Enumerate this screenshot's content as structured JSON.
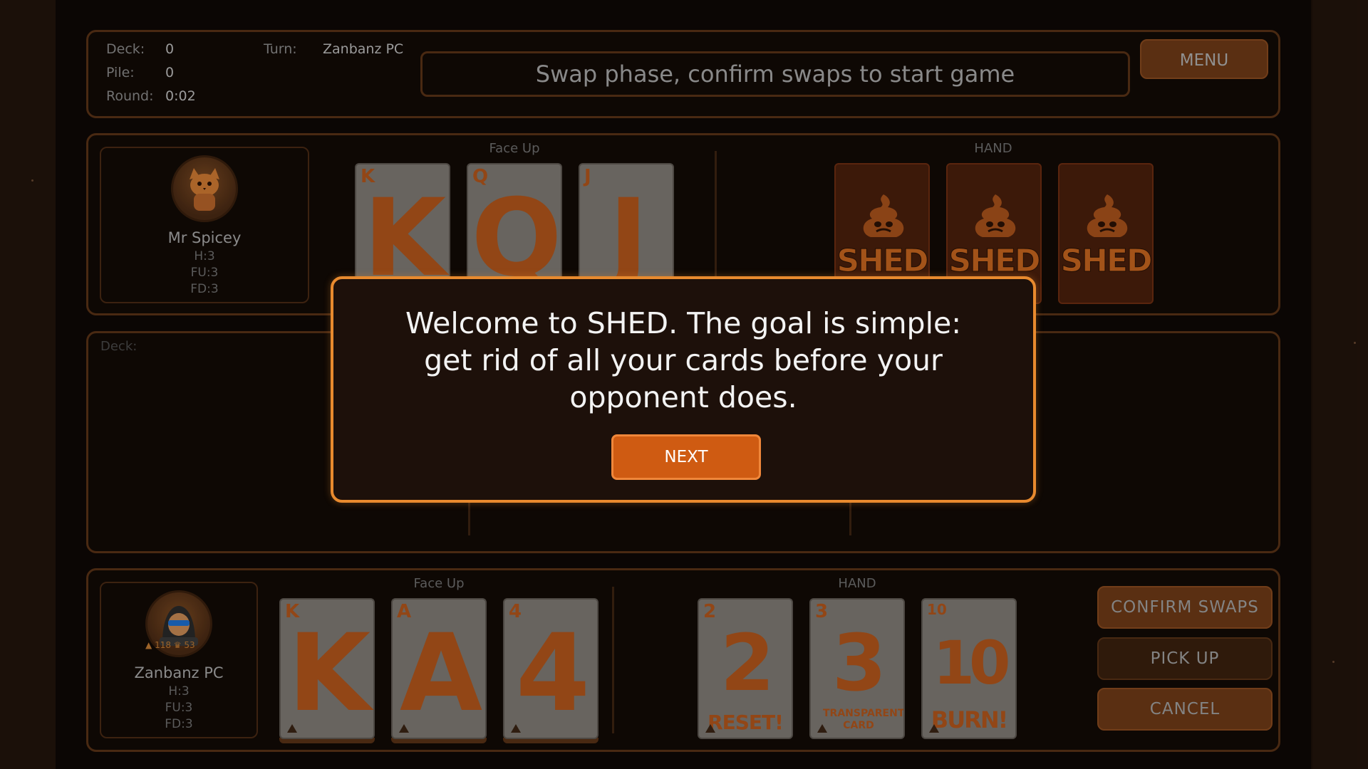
{
  "status": {
    "deck_label": "Deck:",
    "deck_value": "0",
    "pile_label": "Pile:",
    "pile_value": "0",
    "round_label": "Round:",
    "round_value": "0:02",
    "turn_label": "Turn:",
    "turn_value": "Zanbanz PC"
  },
  "message": "Swap phase, confirm swaps to start game",
  "menu_label": "MENU",
  "opponent": {
    "name": "Mr Spicey",
    "h": "H:3",
    "fu": "FU:3",
    "fd": "FD:3",
    "face_up_label": "Face Up",
    "hand_label": "HAND",
    "face_up_cards": [
      {
        "rank": "K"
      },
      {
        "rank": "Q"
      },
      {
        "rank": "J"
      }
    ],
    "hand_cards": [
      {
        "back_text": "SHED"
      },
      {
        "back_text": "SHED"
      },
      {
        "back_text": "SHED"
      }
    ]
  },
  "middle": {
    "deck_label": "Deck:"
  },
  "player": {
    "name": "Zanbanz PC",
    "h": "H:3",
    "fu": "FU:3",
    "fd": "FD:3",
    "badge_a": "118",
    "badge_b": "53",
    "face_up_label": "Face Up",
    "hand_label": "HAND",
    "face_up_cards": [
      {
        "rank": "K"
      },
      {
        "rank": "A"
      },
      {
        "rank": "4"
      }
    ],
    "hand_cards": [
      {
        "rank": "2",
        "caption": "RESET!"
      },
      {
        "rank": "3",
        "caption": "TRANSPARENT CARD"
      },
      {
        "rank": "10",
        "caption": "BURN!"
      }
    ]
  },
  "buttons": {
    "confirm": "CONFIRM SWAPS",
    "pickup": "PICK UP",
    "cancel": "CANCEL"
  },
  "modal": {
    "line1": "Welcome to SHED. The goal is simple:",
    "line2": "get rid of all your cards before your",
    "line3": "opponent does.",
    "next_label": "NEXT"
  },
  "colors": {
    "accent": "#e88a2e",
    "button": "#cf5b12",
    "card_ink": "#b2561c"
  }
}
